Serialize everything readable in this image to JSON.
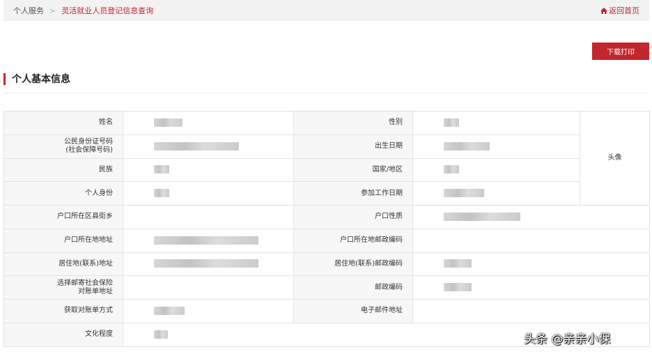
{
  "breadcrumb": {
    "home": "个人服务",
    "separator": ">",
    "current": "灵活就业人员登记信息查询",
    "back_home": "返回首页"
  },
  "toolbar": {
    "print_label": "下载打印"
  },
  "section": {
    "title": "个人基本信息"
  },
  "labels": {
    "name": "姓名",
    "gender": "性别",
    "id_number_line1": "公民身份证号码",
    "id_number_line2": "(社会保障号码)",
    "birth_date": "出生日期",
    "ethnicity": "民族",
    "country": "国家/地区",
    "identity": "个人身份",
    "work_start_date": "参加工作日期",
    "household_district": "户口所在区县街乡",
    "household_type": "户口性质",
    "household_address": "户口所在地地址",
    "household_postcode": "户口所在地邮政编码",
    "residence_address": "居住地(联系)地址",
    "residence_postcode": "居住地(联系)邮政编码",
    "mail_address_line1": "选择邮寄社会保险",
    "mail_address_line2": "对账单地址",
    "postcode": "邮政编码",
    "statement_method": "获取对账单方式",
    "email": "电子邮件地址",
    "education": "文化程度",
    "avatar": "头像"
  },
  "colors": {
    "accent": "#c1272d",
    "label_bg": "#f7f7f7",
    "border": "#e3e3e3"
  },
  "icons": {
    "back_home": "home-icon"
  },
  "watermark": "头条 @亲亲小保"
}
